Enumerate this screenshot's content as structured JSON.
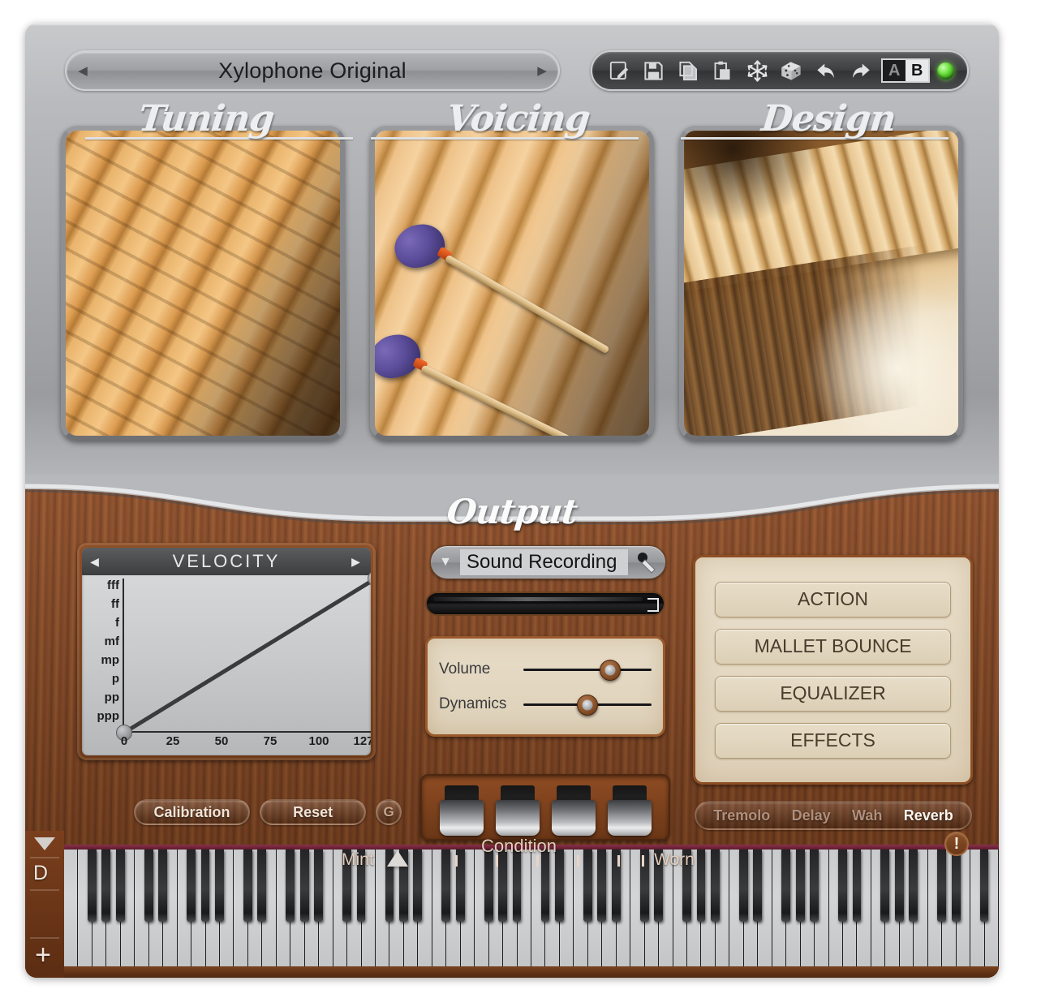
{
  "preset": {
    "name": "Xylophone Original",
    "prev_arrow": "◀",
    "next_arrow": "▶"
  },
  "toolbar": {
    "items": [
      {
        "name": "edit-preset-icon",
        "label": "Edit"
      },
      {
        "name": "save-icon",
        "label": "Save"
      },
      {
        "name": "copy-icon",
        "label": "Copy"
      },
      {
        "name": "paste-icon",
        "label": "Paste"
      },
      {
        "name": "freeze-snowflake-icon",
        "label": "Freeze"
      },
      {
        "name": "randomize-dice-icon",
        "label": "Randomize"
      },
      {
        "name": "undo-icon",
        "label": "Undo"
      },
      {
        "name": "redo-icon",
        "label": "Redo"
      }
    ],
    "ab_a": "A",
    "ab_b": "B",
    "led_color": "#6ee23f"
  },
  "modules": [
    {
      "label": "Tuning",
      "photo": "xylophone-bars-closeup"
    },
    {
      "label": "Voicing",
      "photo": "mallets-on-bars"
    },
    {
      "label": "Design",
      "photo": "full-xylophone-instrument"
    }
  ],
  "output": {
    "title": "Output"
  },
  "velocity": {
    "title": "VELOCITY",
    "prev_arrow": "◀",
    "next_arrow": "▶",
    "buttons": {
      "calibration": "Calibration",
      "reset": "Reset",
      "gain": "G"
    }
  },
  "chart_data": {
    "type": "line",
    "title": "VELOCITY",
    "xlabel": "",
    "ylabel": "",
    "x": [
      0,
      127
    ],
    "values": [
      0,
      7
    ],
    "xlim": [
      0,
      127
    ],
    "ylim": [
      0,
      7
    ],
    "xticks": [
      "0",
      "25",
      "50",
      "75",
      "100",
      "127"
    ],
    "xtick_values": [
      0,
      25,
      50,
      75,
      100,
      127
    ],
    "yticks": [
      "ppp",
      "pp",
      "p",
      "mp",
      "mf",
      "f",
      "ff",
      "fff"
    ],
    "ytick_values": [
      0,
      1,
      2,
      3,
      4,
      5,
      6,
      7
    ],
    "grid": false,
    "legend": "none",
    "line_color": "#3a3b3d",
    "handles": [
      {
        "x": 0,
        "y": 0
      },
      {
        "x": 127,
        "y": 7
      }
    ]
  },
  "mic": {
    "selected": "Sound Recording",
    "chevron": "▼",
    "icon": "microphone-icon"
  },
  "sliders": [
    {
      "label": "Volume",
      "percent": 68
    },
    {
      "label": "Dynamics",
      "percent": 50
    }
  ],
  "pedals": {
    "count": 4,
    "labels": [
      "pedal-1",
      "pedal-2",
      "pedal-3",
      "pedal-4"
    ]
  },
  "module_buttons": [
    "ACTION",
    "MALLET BOUNCE",
    "EQUALIZER",
    "EFFECTS"
  ],
  "effects": [
    {
      "label": "Tremolo",
      "active": false
    },
    {
      "label": "Delay",
      "active": false
    },
    {
      "label": "Wah",
      "active": false
    },
    {
      "label": "Reverb",
      "active": true
    }
  ],
  "condition": {
    "title": "Condition",
    "min_label": "Mint",
    "max_label": "Worn",
    "marker_percent": 12
  },
  "rail": {
    "collapse_arrow": "▼",
    "channel": "D",
    "add": "+"
  },
  "info": {
    "glyph": "!"
  },
  "colors": {
    "silver": "#a9aaad",
    "wood": "#7a3f1d",
    "panel_cream": "#e3d7c0",
    "led_green": "#6ee23f",
    "accent_dark": "#3d3e40"
  }
}
